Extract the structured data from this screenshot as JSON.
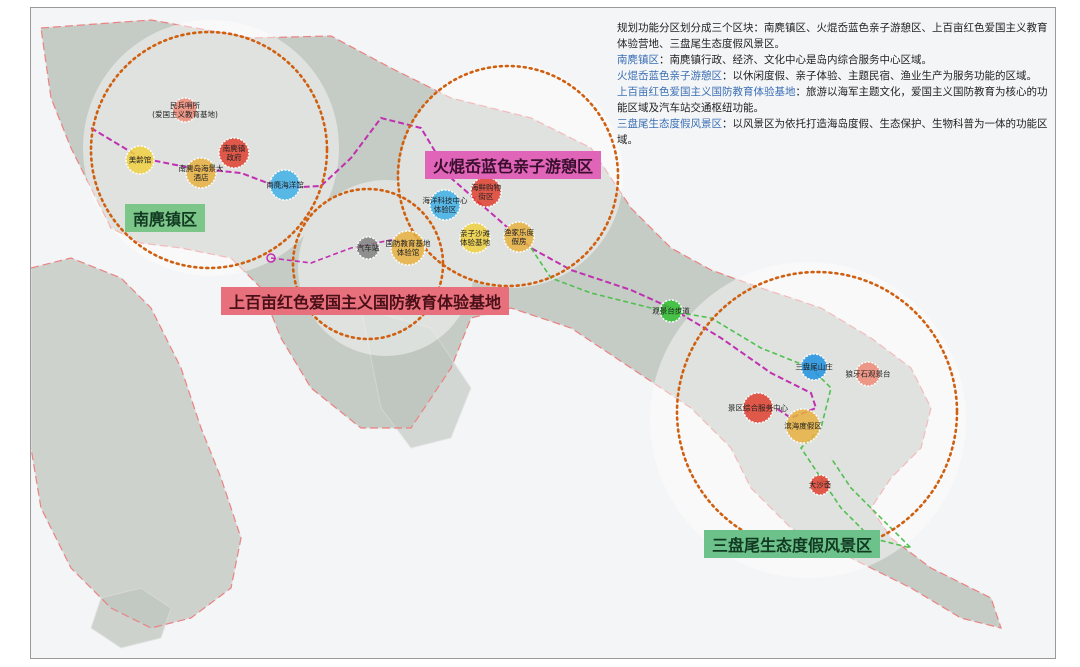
{
  "description": {
    "intro": "规划功能分区划分成三个区块：南麂镇区、火焜岙蓝色亲子游憩区、上百亩红色爱国主义教育体验营地、三盘尾生态度假风景区。",
    "items": [
      {
        "name": "南麂镇区",
        "text": "：南麂镇行政、经济、文化中心是岛内综合服务中心区域。"
      },
      {
        "name": "火焜岙蓝色亲子游憩区",
        "text": "：以休闲度假、亲子体验、主题民宿、渔业生产为服务功能的区域。"
      },
      {
        "name": "上百亩红色爱国主义国防教育体验基地",
        "text": "：旅游以海军主题文化，爱国主义国防教育为核心的功能区域及汽车站交通枢纽功能。"
      },
      {
        "name": "三盘尾生态度假风景区",
        "text": "：以风景区为依托打造海岛度假、生态保护、生物科普为一体的功能区域。"
      }
    ]
  },
  "zones": [
    {
      "label": "南麂镇区",
      "bg": "#7dc68a",
      "fg": "#123a22"
    },
    {
      "label": "火焜岙蓝色亲子游憩区",
      "bg": "#e064b8",
      "fg": "#3a0f2e"
    },
    {
      "label": "上百亩红色爱国主义国防教育体验基地",
      "bg": "#e8707c",
      "fg": "#4a1018"
    },
    {
      "label": "三盘尾生态度假风景区",
      "bg": "#6cc28a",
      "fg": "#123a22"
    }
  ],
  "pois": [
    {
      "label": "民兵哨所\n(爱国主义教育基地)",
      "color": "#f08a78"
    },
    {
      "label": "美龄馆",
      "color": "#f0d040"
    },
    {
      "label": "南麂岛海景大\n酒店",
      "color": "#e8b040"
    },
    {
      "label": "南麂镇\n政府",
      "color": "#e04030"
    },
    {
      "label": "南麂海洋馆",
      "color": "#40b0e8"
    },
    {
      "label": "海洋科技中心\n体验区",
      "color": "#40b0e8"
    },
    {
      "label": "海鲜购物\n街区",
      "color": "#e04030"
    },
    {
      "label": "亲子沙滩\n体验基地",
      "color": "#f0d040"
    },
    {
      "label": "渔家乐度\n假房",
      "color": "#e8b040"
    },
    {
      "label": "汽车站",
      "color": "#808080"
    },
    {
      "label": "国防教育基地\n体验馆",
      "color": "#e8b040"
    },
    {
      "label": "观景台步道",
      "color": "#30c030"
    },
    {
      "label": "三盘尾山庄",
      "color": "#2090e0"
    },
    {
      "label": "狼牙石观景台",
      "color": "#f08a78"
    },
    {
      "label": "景区综合服务中心",
      "color": "#e04030"
    },
    {
      "label": "滨海度假区",
      "color": "#e8b040"
    },
    {
      "label": "大沙岙",
      "color": "#e04030"
    }
  ]
}
